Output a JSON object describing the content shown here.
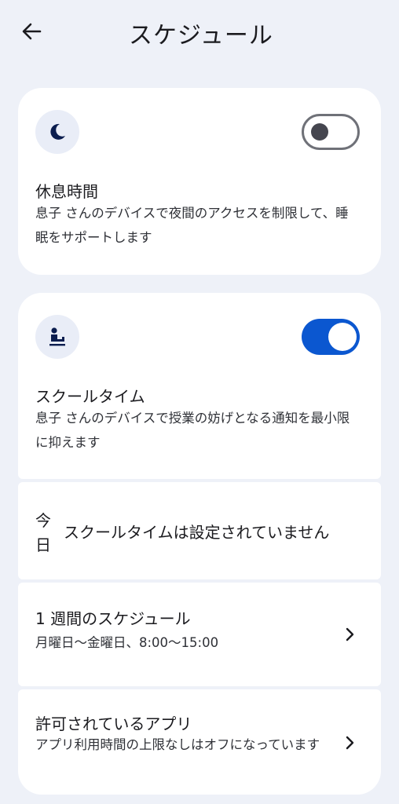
{
  "header": {
    "back_icon": "arrow-left-icon",
    "title": "スケジュール"
  },
  "bedtime": {
    "icon": "moon-icon",
    "toggle_on": false,
    "title": "休息時間",
    "description": "息子 さんのデバイスで夜間のアクセスを制限して、睡眠をサポートします"
  },
  "school_time": {
    "icon": "student-desk-icon",
    "toggle_on": true,
    "title": "スクールタイム",
    "description": "息子 さんのデバイスで授業の妨げとなる通知を最小限に抑えます"
  },
  "today": {
    "label": "今日",
    "text": "スクールタイムは設定されていません"
  },
  "weekly_schedule": {
    "title": "1 週間のスケジュール",
    "subtitle": "月曜日〜金曜日、8:00〜15:00",
    "icon": "chevron-right-icon"
  },
  "allowed_apps": {
    "title": "許可されているアプリ",
    "subtitle": "アプリ利用時間の上限なしはオフになっています",
    "icon": "chevron-right-icon"
  },
  "colors": {
    "background": "#eef1f8",
    "card": "#ffffff",
    "accent": "#0b57d0",
    "icon_dark": "#0b1d4f"
  }
}
